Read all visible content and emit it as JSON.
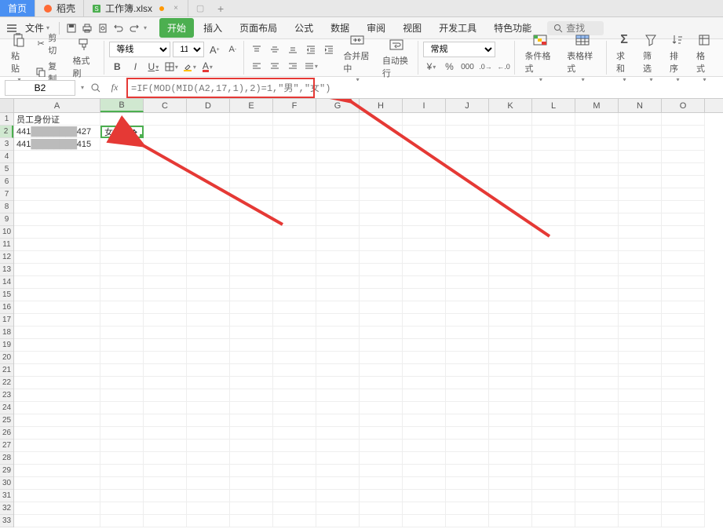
{
  "tabs": {
    "home": "首页",
    "daoke": "稻壳",
    "workbook": "工作簿.xlsx"
  },
  "file_menu": "文件",
  "menu": {
    "start": "开始",
    "insert": "插入",
    "page_layout": "页面布局",
    "formula": "公式",
    "data": "数据",
    "review": "审阅",
    "view": "视图",
    "dev": "开发工具",
    "special": "特色功能"
  },
  "search_placeholder": "查找",
  "ribbon": {
    "paste": "粘贴",
    "cut": "剪切",
    "copy": "复制",
    "format_painter": "格式刷",
    "font_name": "等线",
    "font_size": "11",
    "merge_center": "合并居中",
    "wrap_text": "自动换行",
    "number_format": "常规",
    "cond_format": "条件格式",
    "table_format": "表格样式",
    "sum": "求和",
    "filter": "筛选",
    "sort": "排序",
    "format": "格式"
  },
  "cell_ref": "B2",
  "formula": "=IF(MOD(MID(A2,17,1),2)=1,\"男\",\"女\")",
  "columns": [
    "A",
    "B",
    "C",
    "D",
    "E",
    "F",
    "G",
    "H",
    "I",
    "J",
    "K",
    "L",
    "M",
    "N",
    "O"
  ],
  "sheet": {
    "a1": "员工身份证",
    "a2_prefix": "441",
    "a2_suffix": "427",
    "a3_prefix": "441",
    "a3_suffix": "415",
    "b2": "女"
  },
  "row_count": 33
}
